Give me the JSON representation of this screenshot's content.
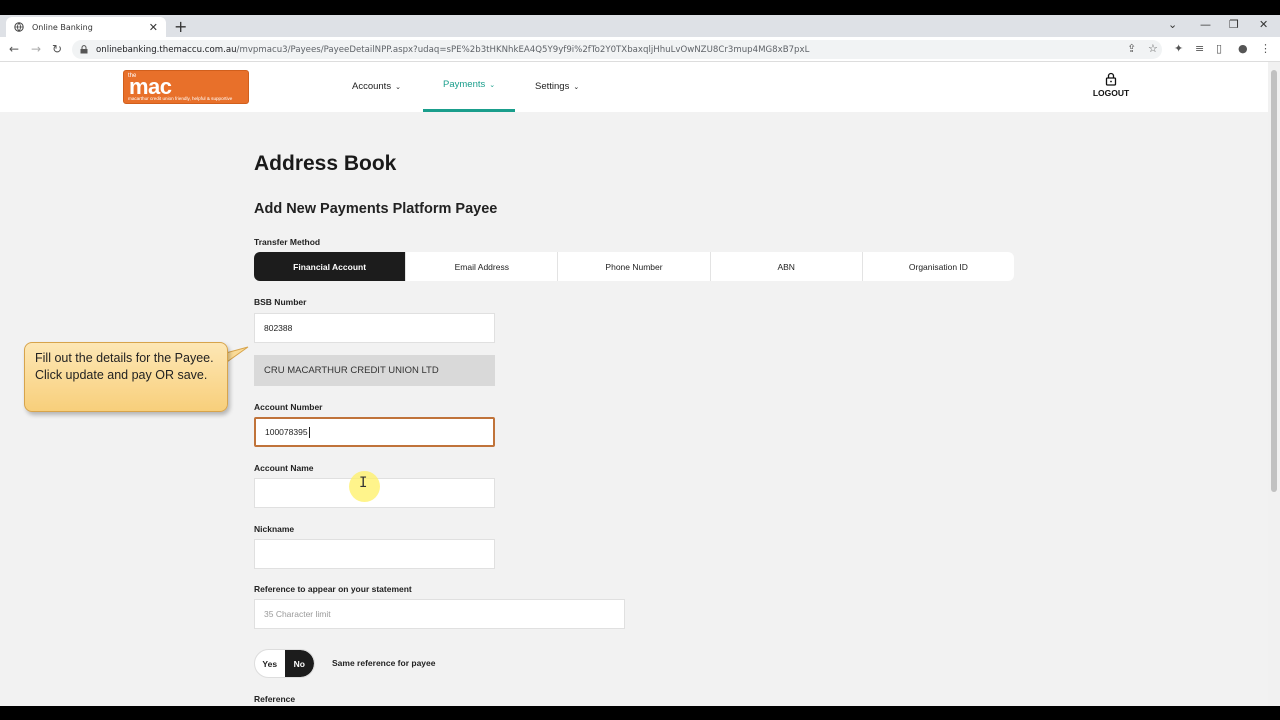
{
  "browser": {
    "tab_title": "Online Banking",
    "tab_close": "✕",
    "new_tab": "+",
    "url_domain": "onlinebanking.themaccu.com.au",
    "url_path": "/mvpmacu3/Payees/PayeeDetailNPP.aspx?udaq=sPE%2b3tHKNhkEA4Q5Y9yf9i%2fTo2Y0TXbaxqljHhuLvOwNZU8Cr3mup4MG8xB7pxL"
  },
  "header": {
    "logo_small": "the",
    "logo_text": "mac",
    "logo_tagline": "macarthur credit union  friendly, helpful & supportive",
    "nav": [
      {
        "label": "Accounts"
      },
      {
        "label": "Payments"
      },
      {
        "label": "Settings"
      }
    ],
    "logout_label": "LOGOUT"
  },
  "page": {
    "title": "Address Book",
    "subtitle": "Add New Payments Platform Payee",
    "transfer_method_label": "Transfer Method",
    "transfer_methods": [
      "Financial Account",
      "Email Address",
      "Phone Number",
      "ABN",
      "Organisation ID"
    ],
    "bsb_label": "BSB Number",
    "bsb_value": "802388",
    "bank_name": "CRU MACARTHUR CREDIT UNION LTD",
    "account_number_label": "Account Number",
    "account_number_value": "100078395",
    "account_name_label": "Account Name",
    "nickname_label": "Nickname",
    "reference_statement_label": "Reference to appear on your statement",
    "reference_statement_placeholder": "35 Character limit",
    "toggle_yes": "Yes",
    "toggle_no": "No",
    "same_reference_label": "Same reference for payee",
    "reference_label": "Reference"
  },
  "callout": {
    "line1": "Fill out the details for the Payee.",
    "line2": "Click update and pay OR save."
  },
  "colors": {
    "accent": "#1a9e8c",
    "logo": "#e8702a",
    "active_segment": "#1c1c1c",
    "focus_border": "#c0733a"
  }
}
